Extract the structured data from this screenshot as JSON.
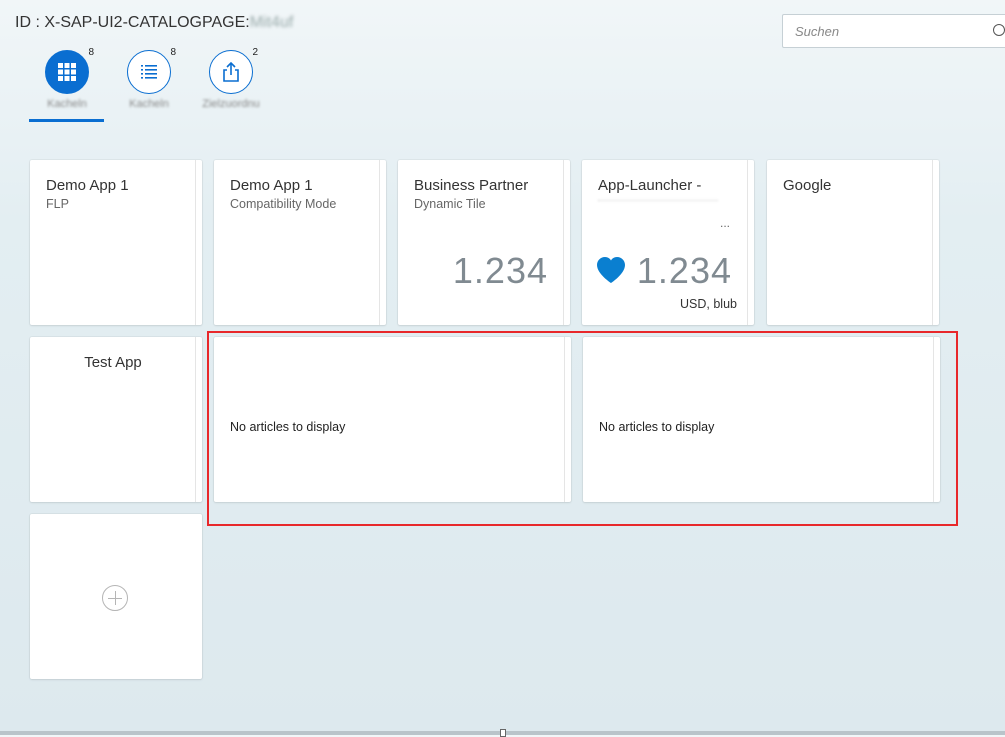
{
  "header": {
    "page_id_prefix": "ID : X-SAP-UI2-CATALOGPAGE:",
    "page_id_suffix": "Mit4uf"
  },
  "search": {
    "placeholder": "Suchen"
  },
  "tabs": [
    {
      "label": "Kacheln",
      "count": "8",
      "icon": "grid-icon",
      "active": true
    },
    {
      "label": "Kacheln",
      "count": "8",
      "icon": "list-icon",
      "active": false
    },
    {
      "label": "Zielzuordnu",
      "count": "2",
      "icon": "share-icon",
      "active": false
    }
  ],
  "tiles": [
    {
      "title": "Demo App 1",
      "subtitle": "FLP"
    },
    {
      "title": "Demo App 1",
      "subtitle": "Compatibility Mode"
    },
    {
      "title": "Business Partner",
      "subtitle": "Dynamic Tile",
      "number": "1.234"
    },
    {
      "title": "App-Launcher -",
      "number": "1.234",
      "unit": "USD, blub",
      "ellipsis": "...",
      "icon": "heart-icon"
    },
    {
      "title": "Google"
    },
    {
      "title": "Test App"
    }
  ],
  "news_tiles": [
    {
      "text": "No articles to display"
    },
    {
      "text": "No articles to display"
    }
  ],
  "colors": {
    "accent": "#0a6ed1",
    "highlight": "#e8282b"
  }
}
